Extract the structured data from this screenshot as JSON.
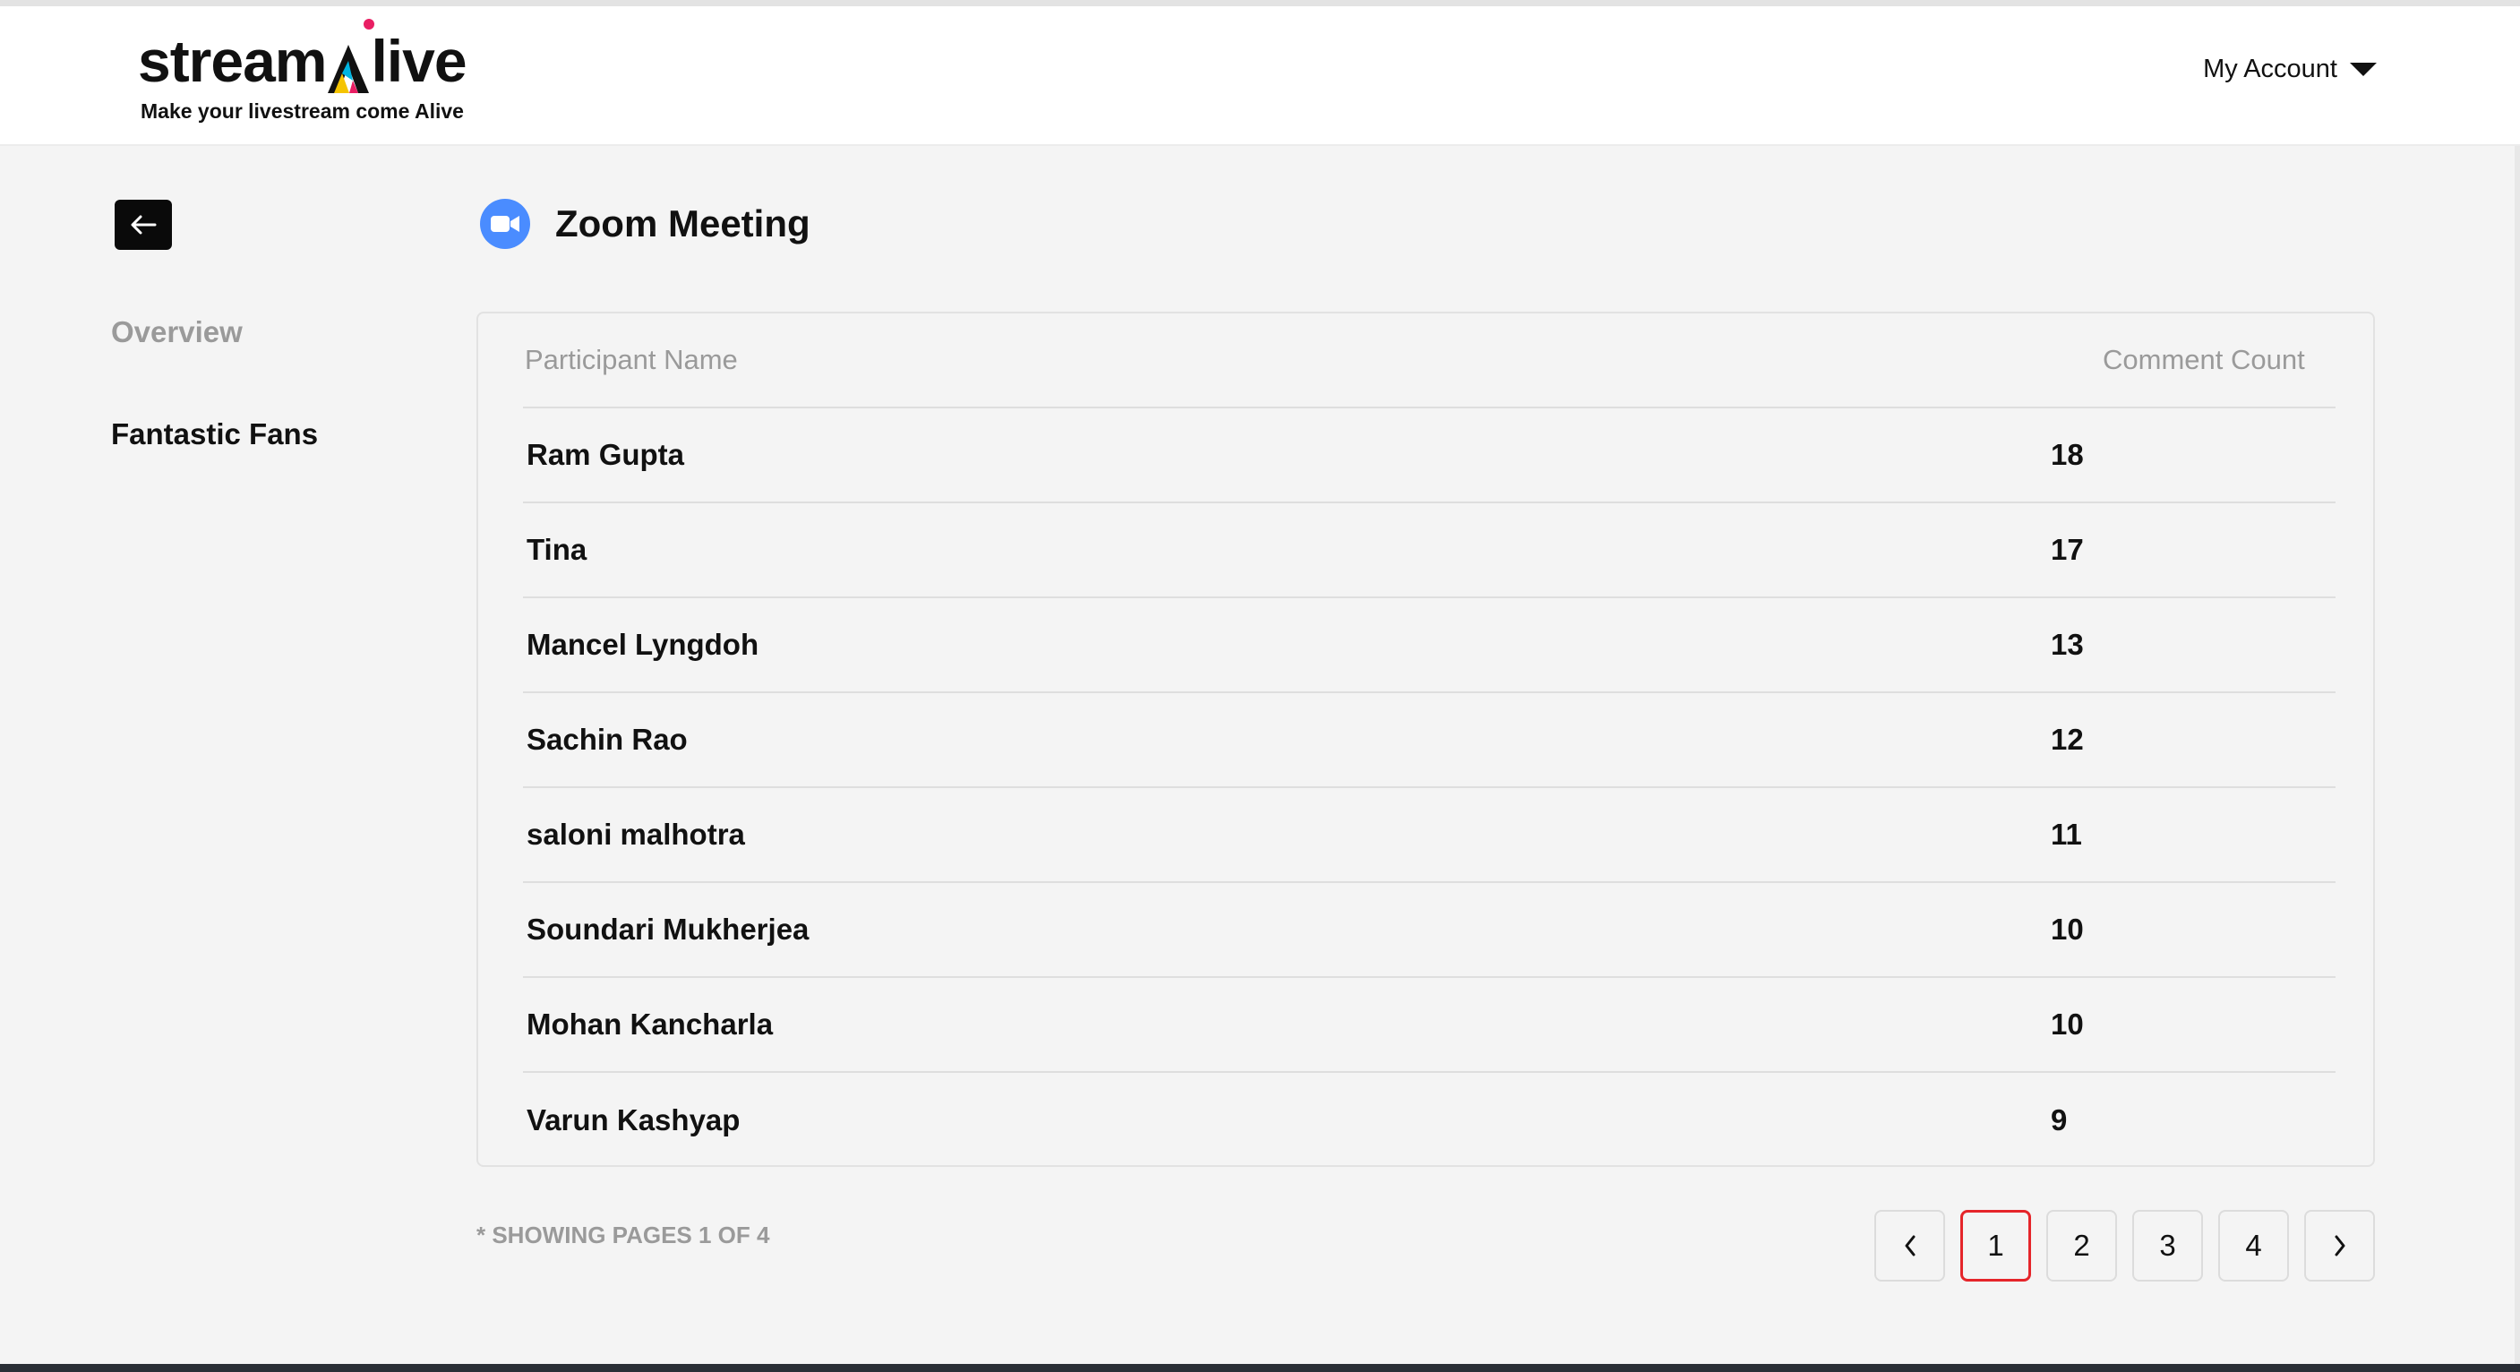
{
  "brand": {
    "name_start": "stream",
    "name_end": "live",
    "tagline": "Make your livestream come Alive"
  },
  "header": {
    "account_label": "My Account"
  },
  "sidebar": {
    "items": [
      {
        "label": "Overview",
        "state": "inactive"
      },
      {
        "label": "Fantastic Fans",
        "state": "active"
      }
    ]
  },
  "page": {
    "title": "Zoom Meeting"
  },
  "table": {
    "columns": [
      "Participant Name",
      "Comment Count"
    ],
    "rows": [
      {
        "name": "Ram Gupta",
        "count": "18"
      },
      {
        "name": "Tina",
        "count": "17"
      },
      {
        "name": "Mancel Lyngdoh",
        "count": "13"
      },
      {
        "name": "Sachin Rao",
        "count": "12"
      },
      {
        "name": "saloni malhotra",
        "count": "11"
      },
      {
        "name": "Soundari Mukherjea",
        "count": "10"
      },
      {
        "name": "Mohan Kancharla",
        "count": "10"
      },
      {
        "name": "Varun Kashyap",
        "count": "9"
      }
    ]
  },
  "pagination": {
    "showing_text": "* SHOWING PAGES 1 OF 4",
    "pages": [
      "1",
      "2",
      "3",
      "4"
    ],
    "current_page": "1"
  },
  "colors": {
    "accent_current_page": "#e5252a",
    "zoom_icon": "#4a8cff",
    "background": "#f4f4f4"
  }
}
